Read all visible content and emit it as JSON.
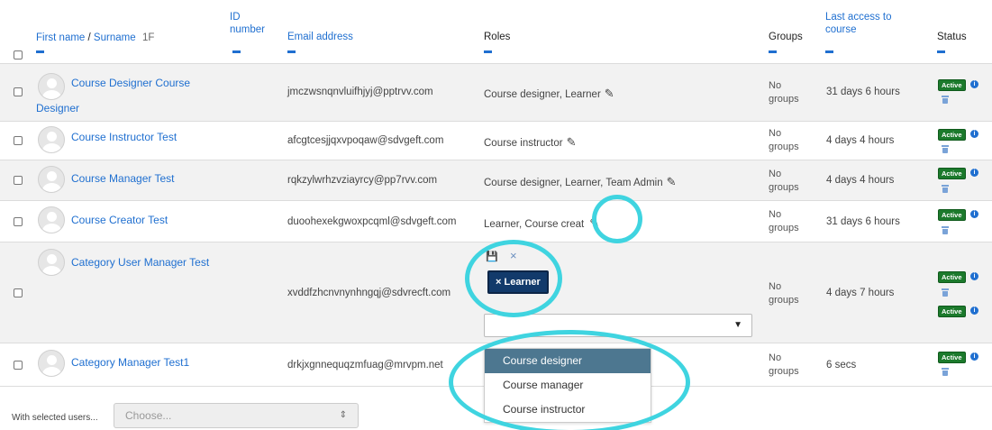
{
  "header": {
    "first_name": "First name",
    "separator": " / ",
    "surname": "Surname",
    "sort_mark": "1F",
    "id_number_line1": "ID",
    "id_number_line2": "number",
    "email": "Email address",
    "roles": "Roles",
    "groups": "Groups",
    "last_access_line1": "Last access to",
    "last_access_line2": "course",
    "status": "Status"
  },
  "rows": [
    {
      "name_line1": "Course Designer Course",
      "name_line2": "Designer",
      "email": "jmczwsnqnvluifhjyj@pptrvv.com",
      "roles": "Course designer, Learner",
      "groups_line1": "No",
      "groups_line2": "groups",
      "last_access": "31 days 6 hours",
      "status": "Active"
    },
    {
      "name_line1": "Course Instructor Test",
      "email": "afcgtcesjjqxvpoqaw@sdvgeft.com",
      "roles": "Course instructor",
      "groups_line1": "No",
      "groups_line2": "groups",
      "last_access": "4 days 4 hours",
      "status": "Active"
    },
    {
      "name_line1": "Course Manager Test",
      "email": "rqkzylwrhzvziayrcy@pp7rvv.com",
      "roles": "Course designer, Learner, Team Admin",
      "groups_line1": "No",
      "groups_line2": "groups",
      "last_access": "4 days 4 hours",
      "status": "Active"
    },
    {
      "name_line1": "Course Creator Test",
      "email": "duoohexekgwoxpcqml@sdvgeft.com",
      "roles": "Learner, Course creat",
      "groups_line1": "No",
      "groups_line2": "groups",
      "last_access": "31 days 6 hours",
      "status": "Active"
    },
    {
      "name_line1": "Category User Manager Test",
      "email": "xvddfzhcnvnynhngqj@sdvrecft.com",
      "roles": "",
      "groups_line1": "No",
      "groups_line2": "groups",
      "last_access": "4 days 7 hours",
      "status": "Active",
      "status2": "Active"
    },
    {
      "name_line1": "Category Manager Test1",
      "email": "drkjxgnnequqzmfuag@mrvpm.net",
      "roles": "",
      "groups_line1": "No",
      "groups_line2": "groups",
      "last_access": "6 secs",
      "status": "Active"
    }
  ],
  "role_editor": {
    "save_icon": "💾",
    "cancel_icon": "×",
    "tag": "× Learner",
    "select_arrow": "▼",
    "options": [
      "Course designer",
      "Course manager",
      "Course instructor"
    ],
    "selected_option": "Course designer"
  },
  "footer": {
    "label": "With selected users...",
    "select_placeholder": "Choose...",
    "select_arrow": "⇕"
  },
  "icons": {
    "pencil": "✎",
    "info": "i"
  },
  "colors": {
    "link": "#1f6fd0",
    "active_badge": "#1c7a2c",
    "highlight_circle": "#3fd4e0",
    "learner_tag": "#123a6b",
    "dropdown_selected": "#4d7790"
  }
}
